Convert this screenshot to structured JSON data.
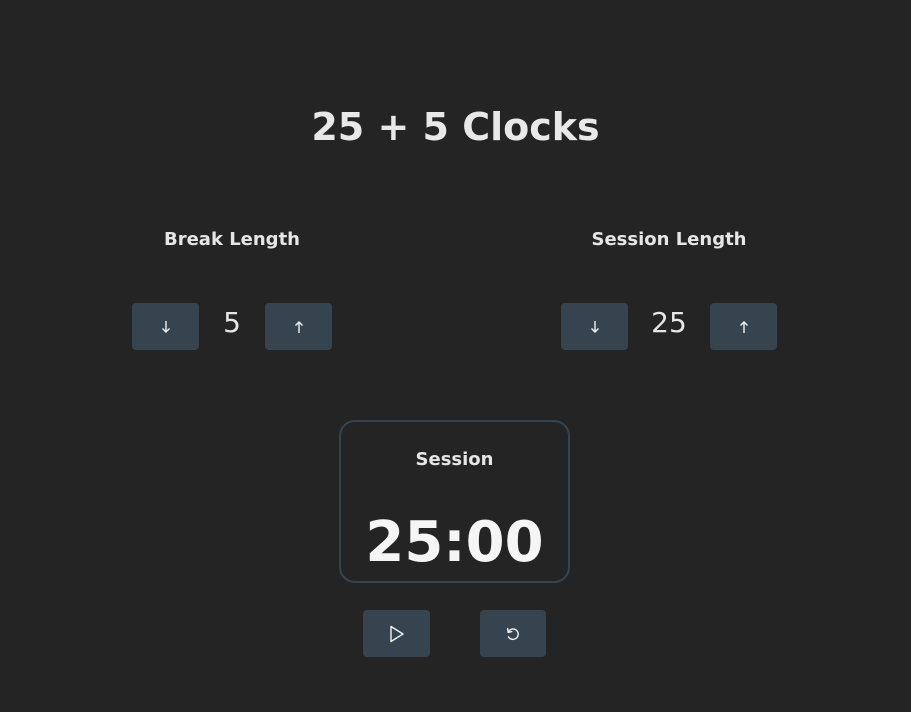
{
  "app": {
    "title": "25 + 5 Clocks"
  },
  "break": {
    "label": "Break Length",
    "value": "5",
    "decrement_icon": "arrow-down-icon",
    "increment_icon": "arrow-up-icon"
  },
  "session": {
    "label": "Session Length",
    "value": "25",
    "decrement_icon": "arrow-down-icon",
    "increment_icon": "arrow-up-icon"
  },
  "timer": {
    "label": "Session",
    "time_left": "25:00"
  },
  "controls": {
    "start_stop_icon": "play-icon",
    "reset_icon": "reset-icon"
  },
  "colors": {
    "background": "#242424",
    "button": "#36444f",
    "text": "#e6e6e6",
    "timer_border": "#36444f"
  }
}
